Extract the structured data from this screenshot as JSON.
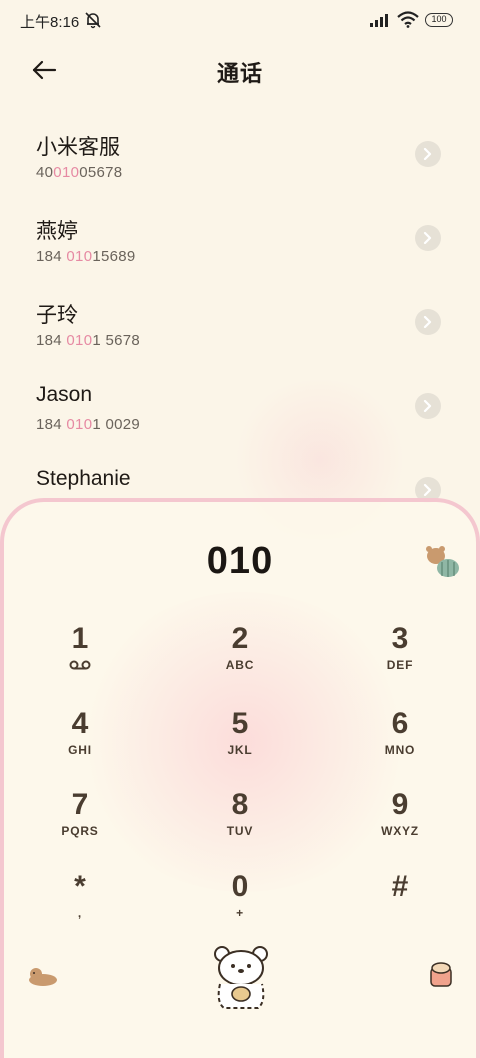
{
  "status_bar": {
    "time": "上午8:16",
    "battery": "100"
  },
  "header": {
    "title": "通话"
  },
  "contacts": [
    {
      "name": "小米客服",
      "number_pre": "40",
      "number_hl": "010",
      "number_post": "05678"
    },
    {
      "name": "燕婷",
      "number_pre": "184 ",
      "number_hl": "010",
      "number_post": "15689"
    },
    {
      "name": "子玲",
      "number_pre": "184 ",
      "number_hl": "010",
      "number_post": "1 5678"
    },
    {
      "name": "Jason",
      "number_pre": "184 ",
      "number_hl": "010",
      "number_post": "1 0029"
    },
    {
      "name": "Stephanie",
      "number_pre": "",
      "number_hl": "",
      "number_post": ""
    }
  ],
  "dialpad": {
    "input": "010",
    "keys": [
      {
        "digit": "1",
        "letters": ""
      },
      {
        "digit": "2",
        "letters": "ABC"
      },
      {
        "digit": "3",
        "letters": "DEF"
      },
      {
        "digit": "4",
        "letters": "GHI"
      },
      {
        "digit": "5",
        "letters": "JKL"
      },
      {
        "digit": "6",
        "letters": "MNO"
      },
      {
        "digit": "7",
        "letters": "PQRS"
      },
      {
        "digit": "8",
        "letters": "TUV"
      },
      {
        "digit": "9",
        "letters": "WXYZ"
      },
      {
        "digit": "*",
        "letters": ","
      },
      {
        "digit": "0",
        "letters": "+"
      },
      {
        "digit": "#",
        "letters": ""
      }
    ]
  },
  "colors": {
    "background": "#fbf5e8",
    "highlight": "#e68aa3",
    "dialpad_border": "#f4c7cf",
    "key_text": "#4a3d30"
  },
  "icons": {
    "back": "arrow-left-icon",
    "mute": "bell-off-icon",
    "voicemail": "voicemail-icon",
    "chevron": "chevron-right-icon"
  }
}
